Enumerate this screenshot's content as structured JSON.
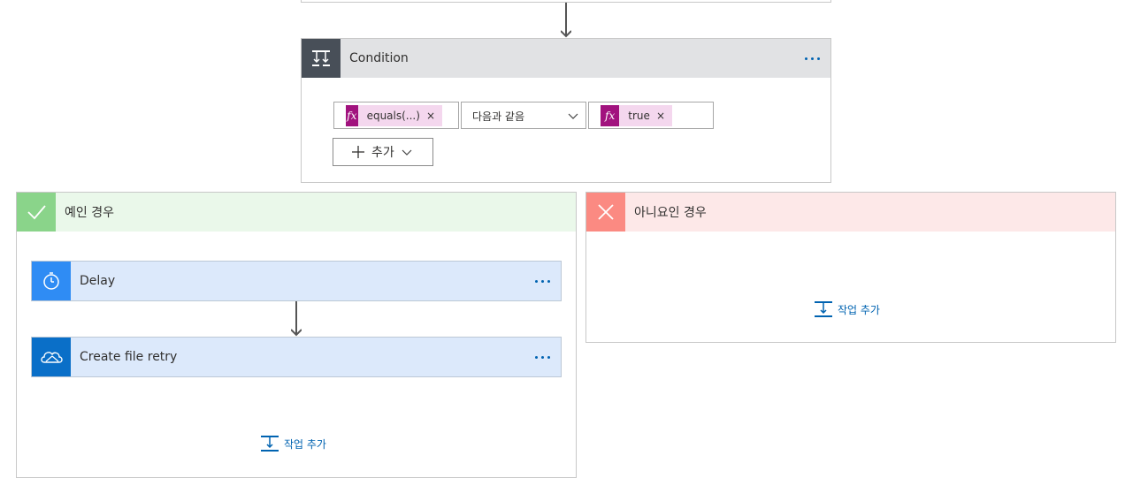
{
  "condition": {
    "title": "Condition",
    "left_token": {
      "label": "equals(...)",
      "remove": "×"
    },
    "operator": "다음과 같음",
    "right_token": {
      "label": "true",
      "remove": "×"
    },
    "add_button_label": "추가",
    "fx_label": "fx"
  },
  "if_yes": {
    "title": "예인 경우",
    "actions": [
      {
        "title": "Delay",
        "icon": "timer-icon"
      },
      {
        "title": "Create file retry",
        "icon": "onedrive-cloud-icon"
      }
    ],
    "add_action_label": "작업 추가"
  },
  "if_no": {
    "title": "아니요인 경우",
    "add_action_label": "작업 추가"
  },
  "colors": {
    "condition_header": "#e1e2e4",
    "condition_icon_bg": "#484f58",
    "yes_header": "#eaf8ea",
    "yes_icon_bg": "#8ad48a",
    "no_header": "#fde8e8",
    "no_icon_bg": "#fb8a82",
    "action_header": "#dce9fb",
    "delay_icon_bg": "#2f8cf4",
    "onedrive_icon_bg": "#0a6fc8",
    "accent": "#0063b1"
  }
}
